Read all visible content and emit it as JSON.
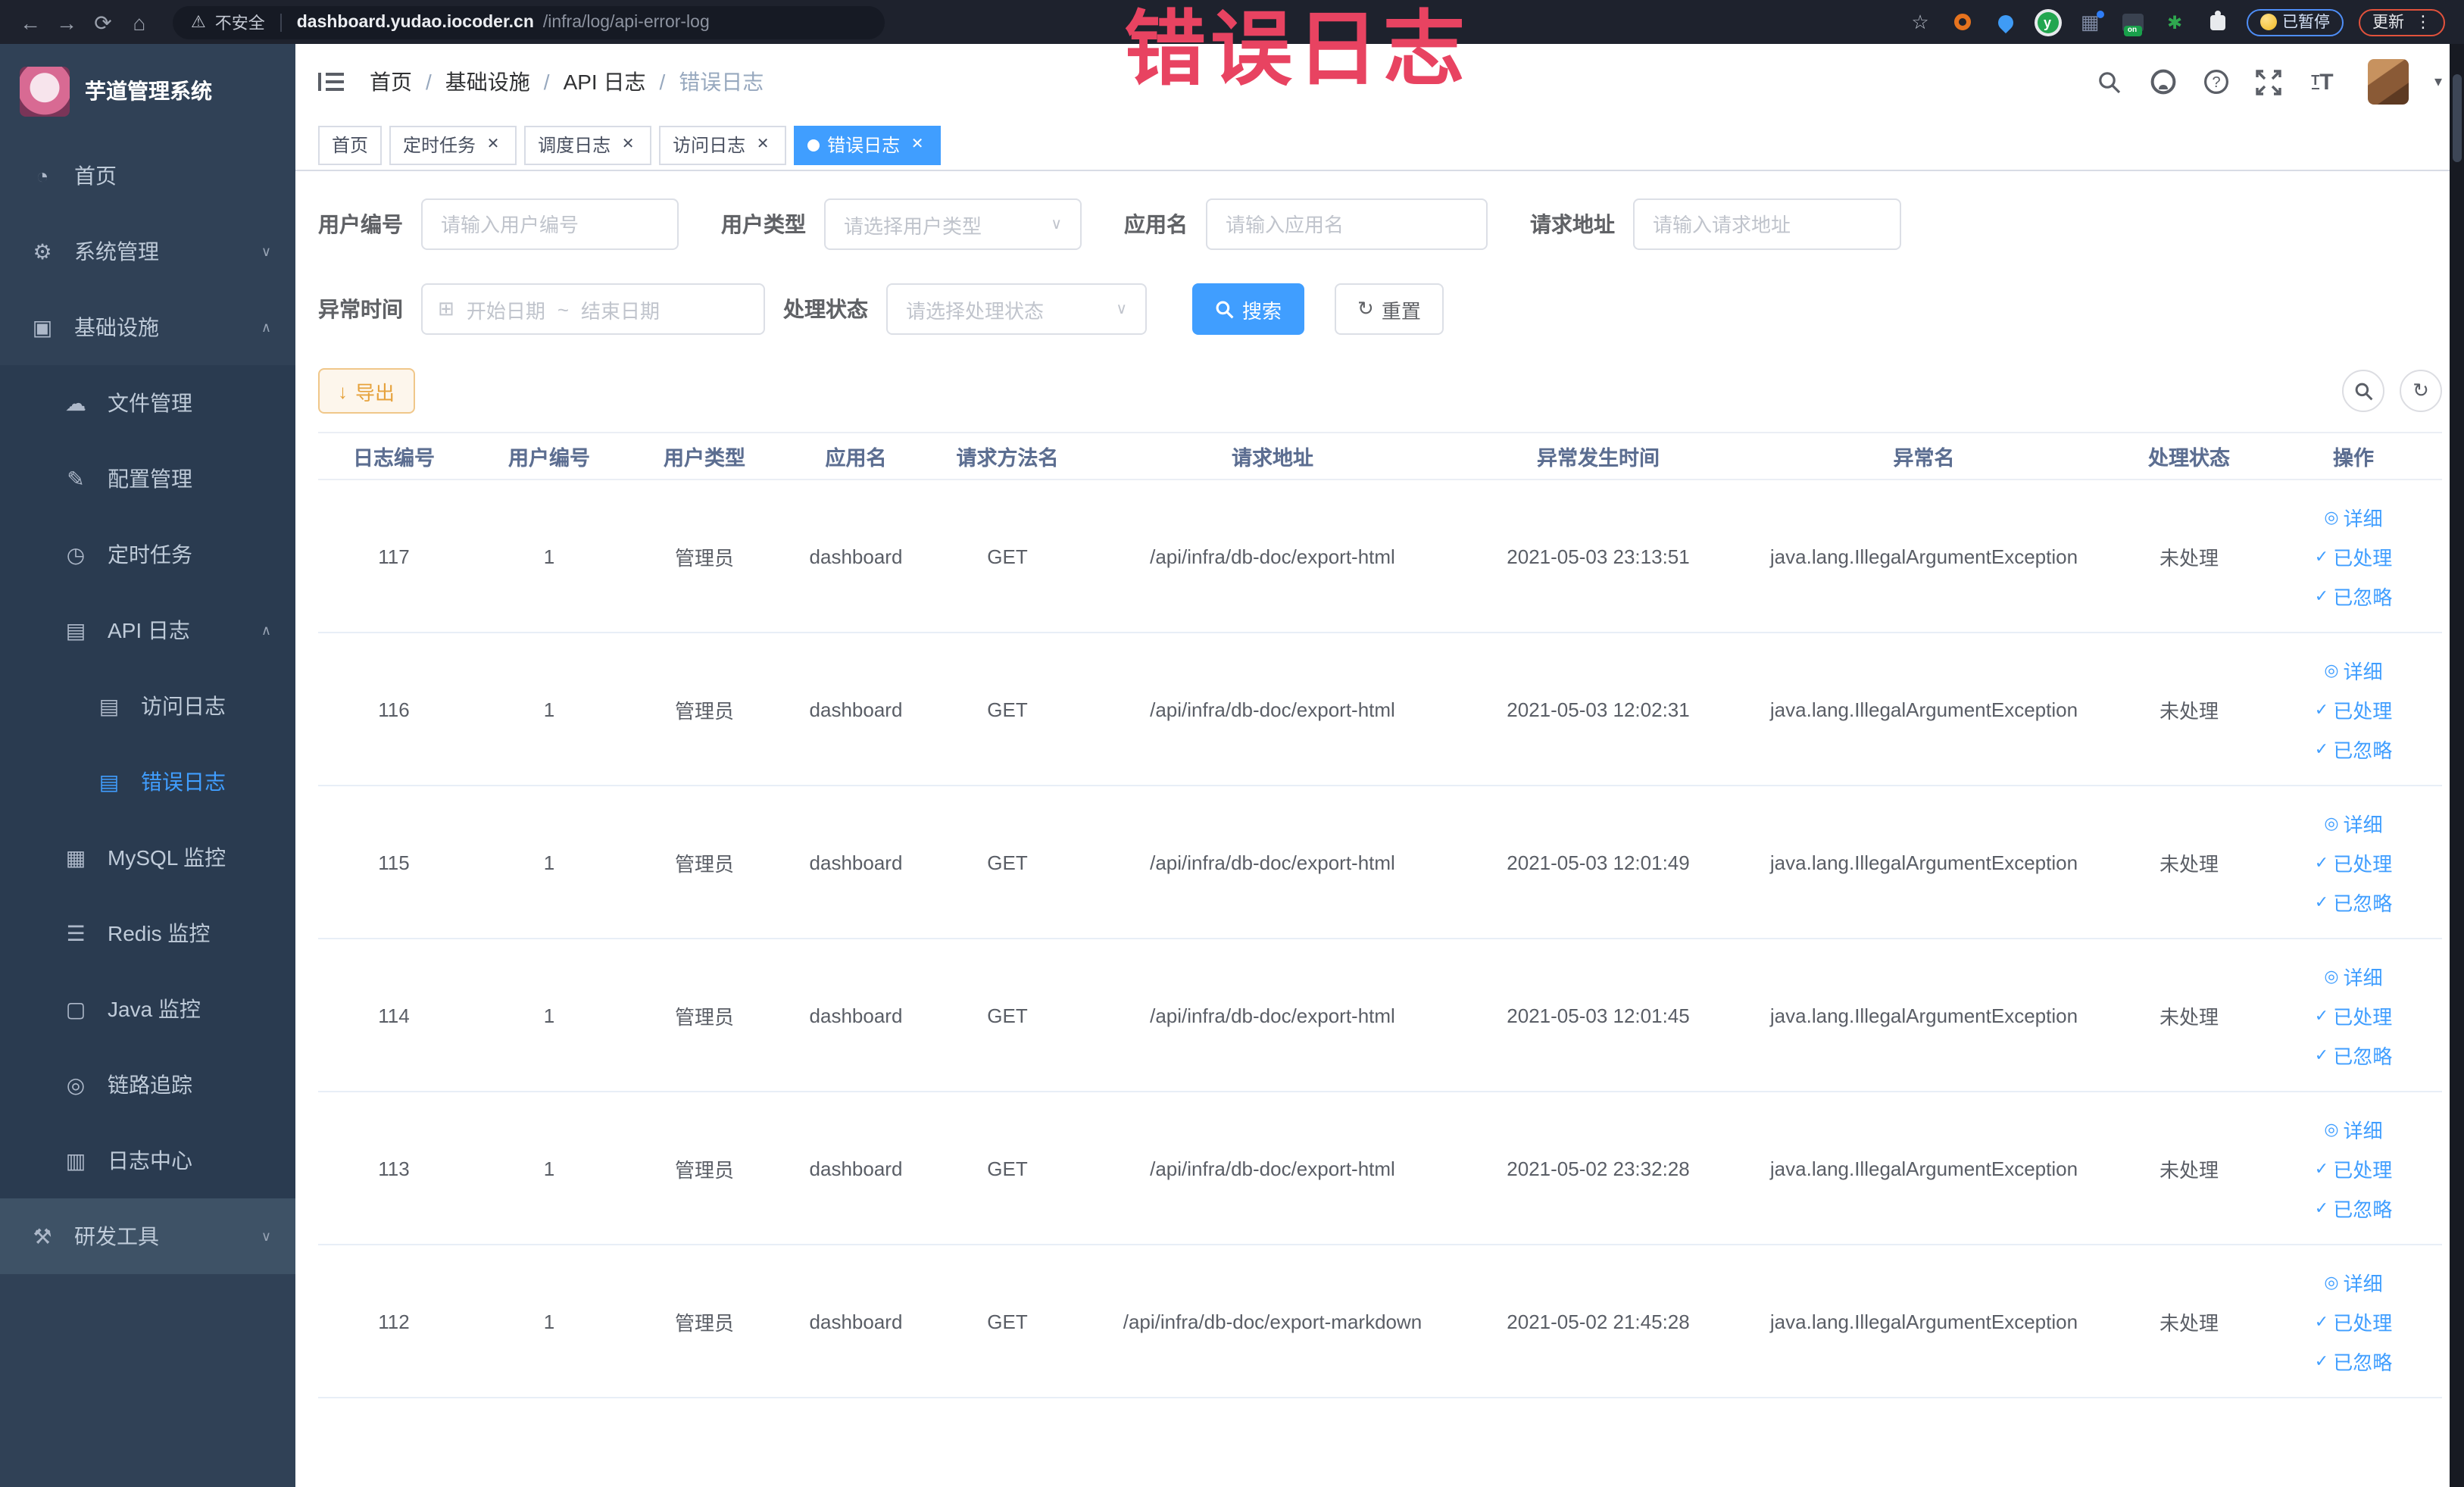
{
  "colors": {
    "accent": "#409eff",
    "overlay_red": "#e84361",
    "warning": "#e6a23c",
    "sidebar_bg": "#304156",
    "chrome_bg": "#1e222d"
  },
  "browser": {
    "security_label": "不安全",
    "url_host": "dashboard.yudao.iocoder.cn",
    "url_path": "/infra/log/api-error-log",
    "paused_badge": "已暂停",
    "update_button": "更新"
  },
  "overlay": {
    "title": "错误日志"
  },
  "icons": {
    "dashboard": "◔",
    "gear": "⚙",
    "monitor": "▣",
    "cloud": "☁",
    "edit": "✎",
    "timer": "◷",
    "log": "▤",
    "mysql": "▦",
    "redis": "☰",
    "java": "▢",
    "trace": "◎",
    "logcenter": "▥",
    "tools": "⚒",
    "chevron_down": "∨",
    "chevron_up": "∧",
    "check": "✓",
    "eye": "◎",
    "refresh": "↻",
    "caret": "▾",
    "warning": "⚠",
    "calendar": "⊞",
    "star": "☆",
    "grid": "▦",
    "leaf": "✱",
    "kebab": "⋮",
    "separator": "~",
    "download": "↓",
    "dots": "⋮"
  },
  "sidebar": {
    "logo_title": "芋道管理系统",
    "items": [
      {
        "label": "首页"
      },
      {
        "label": "系统管理"
      },
      {
        "label": "基础设施"
      },
      {
        "label": "文件管理"
      },
      {
        "label": "配置管理"
      },
      {
        "label": "定时任务"
      },
      {
        "label": "API 日志"
      },
      {
        "label": "访问日志"
      },
      {
        "label": "错误日志"
      },
      {
        "label": "MySQL 监控"
      },
      {
        "label": "Redis 监控"
      },
      {
        "label": "Java 监控"
      },
      {
        "label": "链路追踪"
      },
      {
        "label": "日志中心"
      },
      {
        "label": "研发工具"
      }
    ]
  },
  "header": {
    "breadcrumb": [
      "首页",
      "基础设施",
      "API 日志",
      "错误日志"
    ]
  },
  "tabs": [
    {
      "label": "首页"
    },
    {
      "label": "定时任务"
    },
    {
      "label": "调度日志"
    },
    {
      "label": "访问日志"
    },
    {
      "label": "错误日志"
    }
  ],
  "filters": {
    "user_id": {
      "label": "用户编号",
      "placeholder": "请输入用户编号"
    },
    "user_type": {
      "label": "用户类型",
      "placeholder": "请选择用户类型"
    },
    "app_name": {
      "label": "应用名",
      "placeholder": "请输入应用名"
    },
    "request_url": {
      "label": "请求地址",
      "placeholder": "请输入请求地址"
    },
    "exception_time": {
      "label": "异常时间",
      "start_placeholder": "开始日期",
      "separator": "~",
      "end_placeholder": "结束日期"
    },
    "process_status": {
      "label": "处理状态",
      "placeholder": "请选择处理状态"
    },
    "search_button": "搜索",
    "reset_button": "重置"
  },
  "toolbar": {
    "export_button": "导出"
  },
  "table": {
    "columns": [
      "日志编号",
      "用户编号",
      "用户类型",
      "应用名",
      "请求方法名",
      "请求地址",
      "异常发生时间",
      "异常名",
      "处理状态",
      "操作"
    ],
    "actions": {
      "detail": "详细",
      "processed": "已处理",
      "ignored": "已忽略"
    },
    "rows": [
      {
        "id": "117",
        "user_id": "1",
        "user_type": "管理员",
        "app": "dashboard",
        "method": "GET",
        "url": "/api/infra/db-doc/export-html",
        "time": "2021-05-03 23:13:51",
        "exception": "java.lang.IllegalArgumentException",
        "status": "未处理"
      },
      {
        "id": "116",
        "user_id": "1",
        "user_type": "管理员",
        "app": "dashboard",
        "method": "GET",
        "url": "/api/infra/db-doc/export-html",
        "time": "2021-05-03 12:02:31",
        "exception": "java.lang.IllegalArgumentException",
        "status": "未处理"
      },
      {
        "id": "115",
        "user_id": "1",
        "user_type": "管理员",
        "app": "dashboard",
        "method": "GET",
        "url": "/api/infra/db-doc/export-html",
        "time": "2021-05-03 12:01:49",
        "exception": "java.lang.IllegalArgumentException",
        "status": "未处理"
      },
      {
        "id": "114",
        "user_id": "1",
        "user_type": "管理员",
        "app": "dashboard",
        "method": "GET",
        "url": "/api/infra/db-doc/export-html",
        "time": "2021-05-03 12:01:45",
        "exception": "java.lang.IllegalArgumentException",
        "status": "未处理"
      },
      {
        "id": "113",
        "user_id": "1",
        "user_type": "管理员",
        "app": "dashboard",
        "method": "GET",
        "url": "/api/infra/db-doc/export-html",
        "time": "2021-05-02 23:32:28",
        "exception": "java.lang.IllegalArgumentException",
        "status": "未处理"
      },
      {
        "id": "112",
        "user_id": "1",
        "user_type": "管理员",
        "app": "dashboard",
        "method": "GET",
        "url": "/api/infra/db-doc/export-markdown",
        "time": "2021-05-02 21:45:28",
        "exception": "java.lang.IllegalArgumentException",
        "status": "未处理"
      }
    ]
  }
}
